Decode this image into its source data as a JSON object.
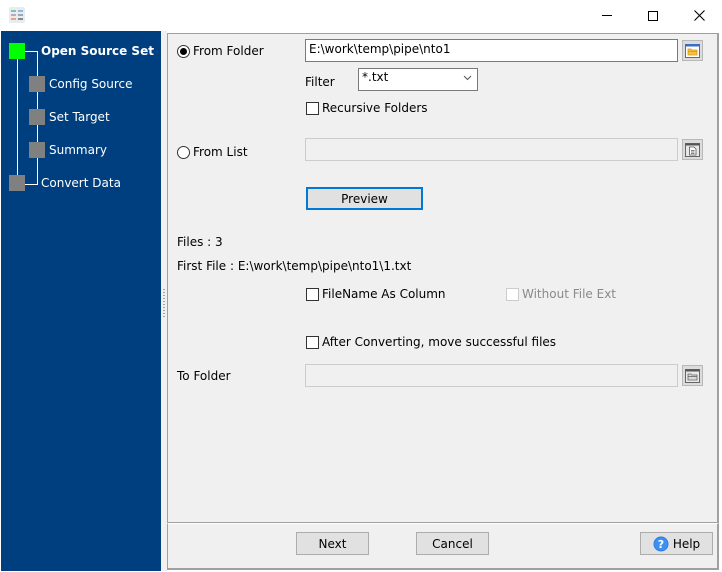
{
  "window": {
    "title": "",
    "controls": {
      "minimize": "minimize",
      "maximize": "maximize",
      "close": "close"
    }
  },
  "sidebar": {
    "steps": [
      {
        "label": "Open Source Set",
        "state": "active"
      },
      {
        "label": "Config Source",
        "state": "pending"
      },
      {
        "label": "Set Target",
        "state": "pending"
      },
      {
        "label": "Summary",
        "state": "pending"
      },
      {
        "label": "Convert Data",
        "state": "pending"
      }
    ]
  },
  "source": {
    "from_folder_label": "From Folder",
    "from_folder_selected": true,
    "folder_path": "E:\\work\\temp\\pipe\\nto1",
    "filter_label": "Filter",
    "filter_value": "*.txt",
    "recursive_label": "Recursive Folders",
    "recursive_checked": false,
    "from_list_label": "From List",
    "from_list_selected": false,
    "list_path": "",
    "preview_label": "Preview"
  },
  "info": {
    "files_count": "Files : 3",
    "first_file": "First File : E:\\work\\temp\\pipe\\nto1\\1.txt"
  },
  "options": {
    "filename_as_column_label": "FileName As Column",
    "filename_as_column_checked": false,
    "without_file_ext_label": "Without File Ext",
    "without_file_ext_enabled": false,
    "after_converting_label": "After Converting, move successful files",
    "after_converting_checked": false,
    "to_folder_label": "To Folder",
    "to_folder_path": ""
  },
  "footer": {
    "next_label": "Next",
    "cancel_label": "Cancel",
    "help_label": "Help"
  },
  "colors": {
    "sidebar_bg": "#003f7f",
    "active_step": "#00ff00",
    "pending_step": "#808080",
    "focus_border": "#0078d7"
  }
}
